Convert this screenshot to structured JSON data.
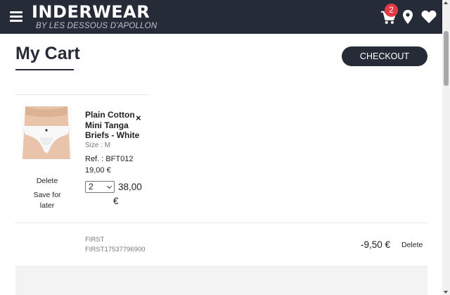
{
  "header": {
    "logo_main": "INDERWEAR",
    "logo_sub": "BY LES DESSOUS D'APOLLON",
    "cart_count": "2",
    "icons": [
      "menu-icon",
      "cart-icon",
      "location-pin-icon",
      "heart-icon"
    ]
  },
  "page": {
    "title": "My Cart",
    "checkout_label": "CHECKOUT"
  },
  "cart_items": [
    {
      "name": "Plain Cotton Mini Tanga Briefs - White",
      "size": "Size : M",
      "ref": "Ref. : BFT012",
      "unit_price": "19,00 €",
      "quantity": "2",
      "line_total": "38,00",
      "currency": "€",
      "delete_label": "Delete",
      "save_later_label": "Save for later",
      "remove_symbol": "×"
    }
  ],
  "promo": {
    "name": "FIRST",
    "code": "FIRST17537796900",
    "amount": "-9,50 €",
    "delete_label": "Delete"
  },
  "colors": {
    "header_bg": "#262b38",
    "badge": "#e63946",
    "button": "#262b38"
  }
}
